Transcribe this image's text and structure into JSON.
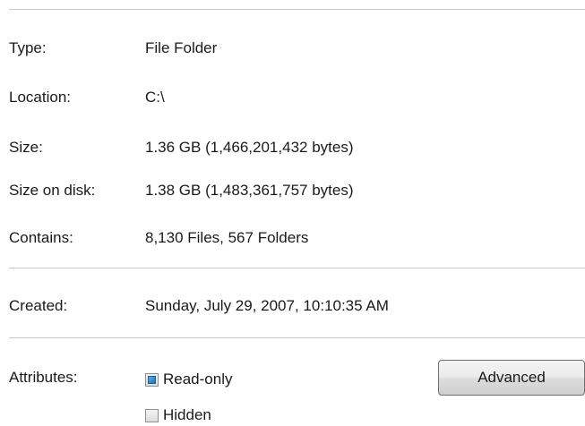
{
  "general": {
    "type": {
      "label": "Type:",
      "value": "File Folder"
    },
    "location": {
      "label": "Location:",
      "value": "C:\\"
    },
    "size": {
      "label": "Size:",
      "value": "1.36 GB (1,466,201,432 bytes)"
    },
    "size_on_disk": {
      "label": "Size on disk:",
      "value": "1.38 GB (1,483,361,757 bytes)"
    },
    "contains": {
      "label": "Contains:",
      "value": "8,130 Files, 567 Folders"
    },
    "created": {
      "label": "Created:",
      "value": "Sunday, July 29, 2007, 10:10:35 AM"
    }
  },
  "attributes": {
    "label": "Attributes:",
    "read_only": {
      "label": "Read-only",
      "state": "indeterminate"
    },
    "hidden": {
      "label": "Hidden",
      "state": "unchecked"
    },
    "advanced_button": "Advanced"
  }
}
